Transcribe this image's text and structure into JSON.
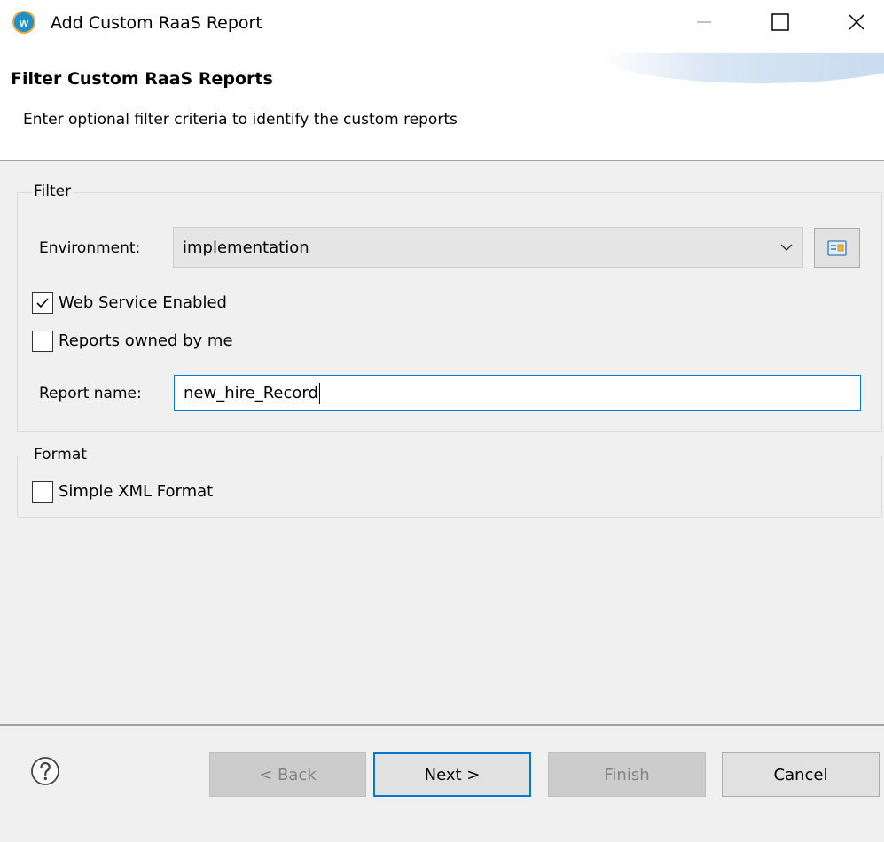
{
  "window": {
    "title": "Add Custom RaaS Report",
    "app_icon_letter": "w"
  },
  "header": {
    "title": "Filter Custom RaaS Reports",
    "description": "Enter optional filter criteria to identify the custom reports"
  },
  "filter": {
    "group_label": "Filter",
    "environment_label": "Environment:",
    "environment_value": "implementation",
    "web_service_enabled": {
      "label": "Web Service Enabled",
      "checked": true
    },
    "reports_owned_by_me": {
      "label": "Reports owned by me",
      "checked": false
    },
    "report_name_label": "Report name:",
    "report_name_value": "new_hire_Record"
  },
  "format": {
    "group_label": "Format",
    "simple_xml": {
      "label": "Simple XML Format",
      "checked": false
    }
  },
  "footer": {
    "back_label": "< Back",
    "next_label": "Next >",
    "finish_label": "Finish",
    "cancel_label": "Cancel"
  },
  "colors": {
    "accent": "#0078d7",
    "app_icon": "#1f8fc9",
    "disabled_text": "#838383"
  },
  "icons": {
    "app": "workday-icon",
    "minimize": "minimize-icon",
    "maximize": "maximize-icon",
    "close": "close-icon",
    "dropdown": "chevron-down-icon",
    "browse": "browse-environment-icon",
    "checkbox_checked": "check-icon",
    "help": "help-icon"
  }
}
